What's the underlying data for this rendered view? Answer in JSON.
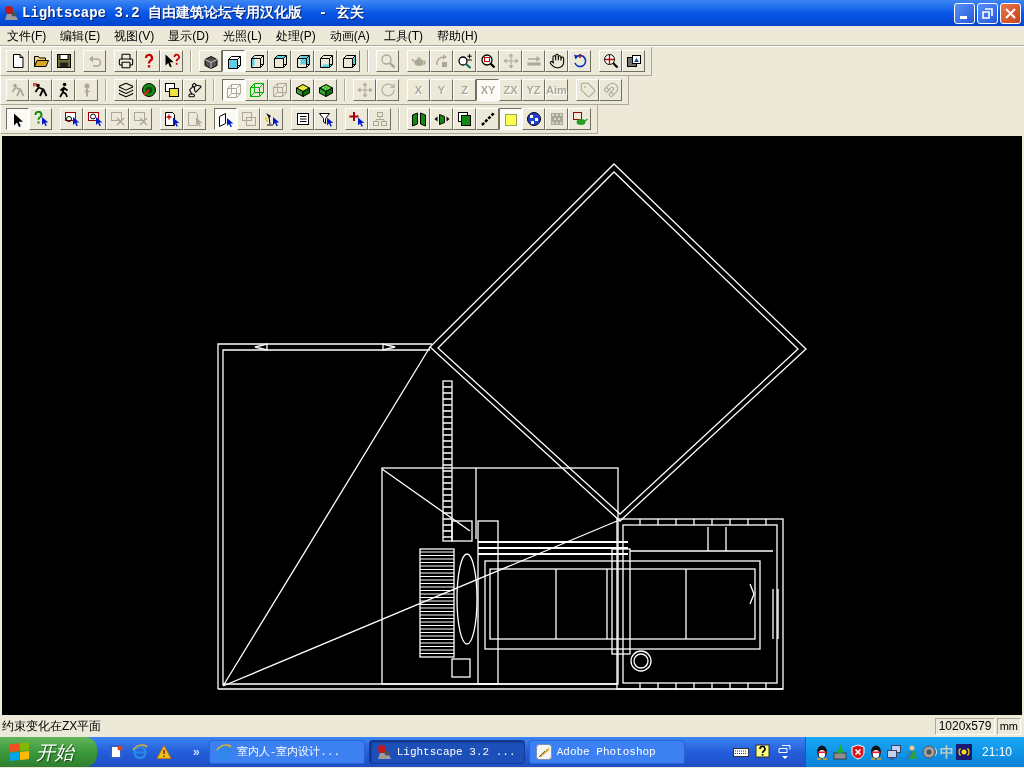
{
  "window": {
    "title": "Lightscape 3.2 自由建筑论坛专用汉化版  - 玄关"
  },
  "menu": [
    "文件(F)",
    "编辑(E)",
    "视图(V)",
    "显示(D)",
    "光照(L)",
    "处理(P)",
    "动画(A)",
    "工具(T)",
    "帮助(H)"
  ],
  "toolbars": [
    {
      "sections": [
        [
          [
            {
              "kind": "new",
              "disabled": false,
              "pressed": false
            },
            {
              "kind": "open",
              "disabled": false,
              "pressed": false
            },
            {
              "kind": "save",
              "disabled": false,
              "pressed": false
            }
          ],
          [
            {
              "kind": "undo",
              "disabled": true,
              "pressed": false
            }
          ],
          [
            {
              "kind": "print",
              "disabled": false,
              "pressed": false
            },
            {
              "kind": "help",
              "disabled": false,
              "pressed": false
            },
            {
              "kind": "whats-this",
              "disabled": false,
              "pressed": false
            }
          ]
        ],
        [
          [
            {
              "kind": "object",
              "disabled": false,
              "pressed": false
            },
            {
              "kind": "cube-front",
              "disabled": false,
              "pressed": true
            },
            {
              "kind": "cube-left",
              "disabled": false,
              "pressed": false
            },
            {
              "kind": "cube-top",
              "disabled": false,
              "pressed": false
            },
            {
              "kind": "cube-back",
              "disabled": false,
              "pressed": false
            },
            {
              "kind": "cube-bottom",
              "disabled": false,
              "pressed": false
            },
            {
              "kind": "cube-right",
              "disabled": false,
              "pressed": false
            }
          ]
        ],
        [
          [
            {
              "kind": "magnifier",
              "disabled": true,
              "pressed": false
            }
          ],
          [
            {
              "kind": "teapot",
              "disabled": true,
              "pressed": false
            },
            {
              "kind": "turn",
              "disabled": true,
              "pressed": false
            },
            {
              "kind": "zoom",
              "disabled": false,
              "pressed": false
            },
            {
              "kind": "zoom-window",
              "disabled": false,
              "pressed": false
            },
            {
              "kind": "pan",
              "disabled": true,
              "pressed": false
            },
            {
              "kind": "dolly",
              "disabled": true,
              "pressed": false
            },
            {
              "kind": "hand",
              "disabled": false,
              "pressed": false
            },
            {
              "kind": "orbit",
              "disabled": false,
              "pressed": false
            }
          ],
          [
            {
              "kind": "zoom-extents",
              "disabled": false,
              "pressed": false
            },
            {
              "kind": "snapshot",
              "disabled": false,
              "pressed": false
            }
          ]
        ]
      ]
    },
    {
      "sections": [
        [
          [
            {
              "kind": "crouch",
              "disabled": true,
              "pressed": false
            },
            {
              "kind": "crouch-mark",
              "disabled": false,
              "pressed": false
            },
            {
              "kind": "walk",
              "disabled": false,
              "pressed": false
            },
            {
              "kind": "stand",
              "disabled": true,
              "pressed": false
            }
          ]
        ],
        [
          [
            {
              "kind": "layers",
              "disabled": false,
              "pressed": false
            },
            {
              "kind": "material",
              "disabled": false,
              "pressed": false
            },
            {
              "kind": "texture",
              "disabled": false,
              "pressed": false
            },
            {
              "kind": "lamp",
              "disabled": false,
              "pressed": false
            }
          ]
        ],
        [
          [
            {
              "kind": "wire-cube",
              "disabled": true,
              "pressed": true
            },
            {
              "kind": "wire-cube",
              "disabled": false,
              "pressed": false
            },
            {
              "kind": "wire-cube",
              "disabled": true,
              "pressed": false
            },
            {
              "kind": "shaded-cube",
              "disabled": false,
              "pressed": false
            },
            {
              "kind": "solid-cube",
              "disabled": false,
              "pressed": false
            }
          ]
        ],
        [
          [
            {
              "kind": "pan",
              "disabled": true,
              "pressed": false
            },
            {
              "kind": "rotate",
              "disabled": true,
              "pressed": false
            }
          ],
          [
            {
              "kind": "text",
              "label": "X",
              "disabled": true,
              "pressed": false
            },
            {
              "kind": "text",
              "label": "Y",
              "disabled": true,
              "pressed": false
            },
            {
              "kind": "text",
              "label": "Z",
              "disabled": true,
              "pressed": false
            },
            {
              "kind": "text",
              "label": "XY",
              "disabled": true,
              "pressed": true
            },
            {
              "kind": "text",
              "label": "ZX",
              "disabled": true,
              "pressed": false
            },
            {
              "kind": "text",
              "label": "YZ",
              "disabled": true,
              "pressed": false
            },
            {
              "kind": "text",
              "label": "Aim",
              "disabled": true,
              "pressed": false
            }
          ],
          [
            {
              "kind": "tag",
              "disabled": true,
              "pressed": false
            },
            {
              "kind": "magnet",
              "disabled": true,
              "pressed": false
            }
          ]
        ]
      ]
    },
    {
      "sections": [
        [
          [
            {
              "kind": "select",
              "disabled": false,
              "pressed": true
            },
            {
              "kind": "query",
              "disabled": false,
              "pressed": false
            }
          ],
          [
            {
              "kind": "select-window",
              "disabled": false,
              "pressed": false
            },
            {
              "kind": "select-crossing",
              "disabled": false,
              "pressed": false
            },
            {
              "kind": "deselect-window",
              "disabled": true,
              "pressed": false
            },
            {
              "kind": "deselect-crossing",
              "disabled": true,
              "pressed": false
            }
          ],
          [
            {
              "kind": "page-add",
              "disabled": false,
              "pressed": false
            },
            {
              "kind": "page-select",
              "disabled": true,
              "pressed": false
            }
          ],
          [
            {
              "kind": "plane-pick",
              "disabled": false,
              "pressed": true
            },
            {
              "kind": "stack",
              "disabled": true,
              "pressed": false
            },
            {
              "kind": "lamp-pick",
              "disabled": false,
              "pressed": false
            }
          ],
          [
            {
              "kind": "list",
              "disabled": false,
              "pressed": false
            },
            {
              "kind": "filter",
              "disabled": false,
              "pressed": false
            }
          ],
          [
            {
              "kind": "add-point",
              "disabled": false,
              "pressed": false
            },
            {
              "kind": "hierarchy",
              "disabled": true,
              "pressed": false
            }
          ]
        ],
        [
          [
            {
              "kind": "flip",
              "disabled": false,
              "pressed": false
            },
            {
              "kind": "mirror",
              "disabled": false,
              "pressed": false
            },
            {
              "kind": "copy-box",
              "disabled": false,
              "pressed": false
            },
            {
              "kind": "dashed-line",
              "disabled": false,
              "pressed": false
            },
            {
              "kind": "swatch",
              "disabled": false,
              "pressed": true
            },
            {
              "kind": "globe",
              "disabled": false,
              "pressed": false
            },
            {
              "kind": "pattern",
              "disabled": true,
              "pressed": false
            },
            {
              "kind": "teapot-frame",
              "disabled": false,
              "pressed": false
            }
          ]
        ]
      ]
    }
  ],
  "status_bar": {
    "message": "约束变化在ZX平面",
    "size": "1020x579",
    "units": "mm"
  },
  "taskbar": {
    "start": "开始",
    "more": "»",
    "tasks": [
      {
        "label": "室内人-室内设计...",
        "selected": false
      },
      {
        "label": "Lightscape 3.2 ...",
        "selected": true
      },
      {
        "label": "Adobe Photoshop",
        "selected": false
      }
    ],
    "ime": "中",
    "clock": "21:10"
  }
}
